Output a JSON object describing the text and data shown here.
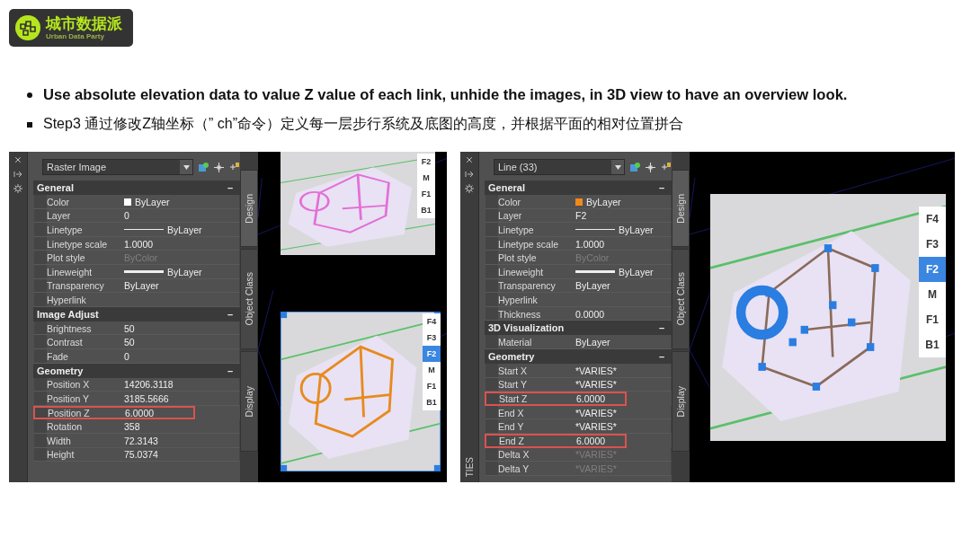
{
  "logo": {
    "title": "城市数据派",
    "subtitle": "Urban Data Party"
  },
  "bullets": [
    {
      "kind": "disc",
      "text": "Use absolute elevation data to value Z value of each link, unhide the images, in 3D view to have an overview look."
    },
    {
      "kind": "square",
      "text": "Step3  通过修改Z轴坐标（” ch”命令）定义每一层步行系统及底图的高度，并根据平面的相对位置拼合"
    }
  ],
  "screenshots": [
    {
      "panel": {
        "object_type": "Raster Image",
        "sections": [
          {
            "title": "General",
            "toggle": "–",
            "rows": [
              {
                "label": "Color",
                "value": "ByLayer",
                "kind": "swatch",
                "color": "#ffffff",
                "dimmed": false,
                "highlighted": false
              },
              {
                "label": "Layer",
                "value": "0",
                "kind": "text",
                "dimmed": false,
                "highlighted": false
              },
              {
                "label": "Linetype",
                "value": "ByLayer",
                "kind": "line",
                "dimmed": false,
                "highlighted": false
              },
              {
                "label": "Linetype scale",
                "value": "1.0000",
                "kind": "text",
                "dimmed": false,
                "highlighted": false
              },
              {
                "label": "Plot style",
                "value": "ByColor",
                "kind": "text",
                "dimmed": true,
                "highlighted": false
              },
              {
                "label": "Lineweight",
                "value": "ByLayer",
                "kind": "thick-line",
                "dimmed": false,
                "highlighted": false
              },
              {
                "label": "Transparency",
                "value": "ByLayer",
                "kind": "text",
                "dimmed": false,
                "highlighted": false
              },
              {
                "label": "Hyperlink",
                "highlighted": false
              }
            ]
          },
          {
            "title": "Image Adjust",
            "toggle": "–",
            "rows": [
              {
                "label": "Brightness",
                "value": "50",
                "kind": "text",
                "dimmed": false,
                "highlighted": false
              },
              {
                "label": "Contrast",
                "value": "50",
                "kind": "text",
                "dimmed": false,
                "highlighted": false
              },
              {
                "label": "Fade",
                "value": "0",
                "kind": "text",
                "dimmed": false,
                "highlighted": false
              }
            ]
          },
          {
            "title": "Geometry",
            "toggle": "–",
            "rows": [
              {
                "label": "Position X",
                "value": "14206.3118",
                "kind": "text",
                "dimmed": false,
                "highlighted": false
              },
              {
                "label": "Position Y",
                "value": "3185.5666",
                "kind": "text",
                "dimmed": false,
                "highlighted": false
              },
              {
                "label": "Position Z",
                "value": "6.0000",
                "kind": "text",
                "dimmed": false,
                "highlighted": true
              },
              {
                "label": "Rotation",
                "value": "358",
                "kind": "text",
                "dimmed": false,
                "highlighted": false
              },
              {
                "label": "Width",
                "value": "72.3143",
                "kind": "text",
                "dimmed": false,
                "highlighted": false
              },
              {
                "label": "Height",
                "value": "75.0374",
                "kind": "text",
                "dimmed": false,
                "highlighted": false
              }
            ]
          }
        ],
        "side_tabs": [
          {
            "label": "Design",
            "selected": true
          },
          {
            "label": "Object Class",
            "selected": false
          },
          {
            "label": "Display",
            "selected": false
          }
        ]
      },
      "maps": [
        {
          "kind": "pink",
          "selected": false,
          "floors": [
            {
              "label": "F2",
              "selected": false
            },
            {
              "label": "M",
              "selected": false
            },
            {
              "label": "F1",
              "selected": false
            },
            {
              "label": "B1",
              "selected": false
            }
          ]
        },
        {
          "kind": "orange",
          "selected": true,
          "floors": [
            {
              "label": "F4",
              "selected": false
            },
            {
              "label": "F3",
              "selected": false
            },
            {
              "label": "F2",
              "selected": true
            },
            {
              "label": "M",
              "selected": false
            },
            {
              "label": "F1",
              "selected": false
            },
            {
              "label": "B1",
              "selected": false
            }
          ]
        }
      ]
    },
    {
      "palette_label": "TIES",
      "panel": {
        "object_type": "Line (33)",
        "sections": [
          {
            "title": "General",
            "toggle": "–",
            "rows": [
              {
                "label": "Color",
                "value": "ByLayer",
                "kind": "swatch",
                "color": "#f08a1c",
                "dimmed": false,
                "highlighted": false
              },
              {
                "label": "Layer",
                "value": "F2",
                "kind": "text",
                "dimmed": false,
                "highlighted": false
              },
              {
                "label": "Linetype",
                "value": "ByLayer",
                "kind": "line",
                "dimmed": false,
                "highlighted": false
              },
              {
                "label": "Linetype scale",
                "value": "1.0000",
                "kind": "text",
                "dimmed": false,
                "highlighted": false
              },
              {
                "label": "Plot style",
                "value": "ByColor",
                "kind": "text",
                "dimmed": true,
                "highlighted": false
              },
              {
                "label": "Lineweight",
                "value": "ByLayer",
                "kind": "thick-line",
                "dimmed": false,
                "highlighted": false
              },
              {
                "label": "Transparency",
                "value": "ByLayer",
                "kind": "text",
                "dimmed": false,
                "highlighted": false
              },
              {
                "label": "Hyperlink",
                "highlighted": false
              },
              {
                "label": "Thickness",
                "value": "0.0000",
                "kind": "text",
                "dimmed": false,
                "highlighted": false
              }
            ]
          },
          {
            "title": "3D Visualization",
            "toggle": "–",
            "rows": [
              {
                "label": "Material",
                "value": "ByLayer",
                "kind": "text",
                "dimmed": false,
                "highlighted": false
              }
            ]
          },
          {
            "title": "Geometry",
            "toggle": "–",
            "rows": [
              {
                "label": "Start X",
                "value": "*VARIES*",
                "kind": "text",
                "dimmed": false,
                "highlighted": false
              },
              {
                "label": "Start Y",
                "value": "*VARIES*",
                "kind": "text",
                "dimmed": false,
                "highlighted": false
              },
              {
                "label": "Start Z",
                "value": "6.0000",
                "kind": "text",
                "dimmed": false,
                "highlighted": true
              },
              {
                "label": "End X",
                "value": "*VARIES*",
                "kind": "text",
                "dimmed": false,
                "highlighted": false
              },
              {
                "label": "End Y",
                "value": "*VARIES*",
                "kind": "text",
                "dimmed": false,
                "highlighted": false
              },
              {
                "label": "End Z",
                "value": "6.0000",
                "kind": "text",
                "dimmed": false,
                "highlighted": true
              },
              {
                "label": "Delta X",
                "value": "*VARIES*",
                "kind": "text",
                "dimmed": true,
                "highlighted": false
              },
              {
                "label": "Delta Y",
                "value": "*VARIES*",
                "kind": "text",
                "dimmed": true,
                "highlighted": false
              }
            ]
          }
        ],
        "side_tabs": [
          {
            "label": "Design",
            "selected": true
          },
          {
            "label": "Object Class",
            "selected": false
          },
          {
            "label": "Display",
            "selected": false
          }
        ]
      },
      "maps": [
        {
          "kind": "blue",
          "selected": false,
          "floors": [
            {
              "label": "F4",
              "selected": false
            },
            {
              "label": "F3",
              "selected": false
            },
            {
              "label": "F2",
              "selected": true
            },
            {
              "label": "M",
              "selected": false
            },
            {
              "label": "F1",
              "selected": false
            },
            {
              "label": "B1",
              "selected": false
            }
          ]
        }
      ]
    }
  ]
}
